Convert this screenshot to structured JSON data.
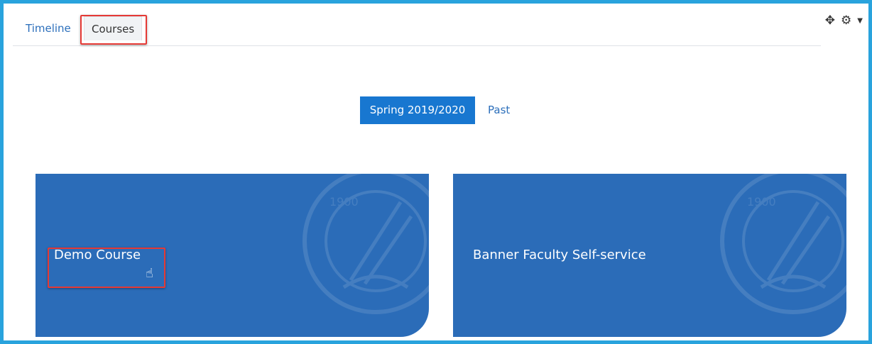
{
  "tabs": {
    "timeline": "Timeline",
    "courses": "Courses"
  },
  "toolbar": {
    "move_icon": "move-icon",
    "settings_icon": "gear-icon"
  },
  "filters": {
    "active": "Spring 2019/2020",
    "past": "Past"
  },
  "courses": [
    {
      "title": "Demo Course",
      "emblem_text": "1900"
    },
    {
      "title": "Banner Faculty Self-service",
      "emblem_text": "1900"
    }
  ],
  "colors": {
    "frame": "#29a3dd",
    "card": "#2b6cb8",
    "button": "#1877d0",
    "link": "#2c6fbb",
    "highlight": "#e53935"
  }
}
